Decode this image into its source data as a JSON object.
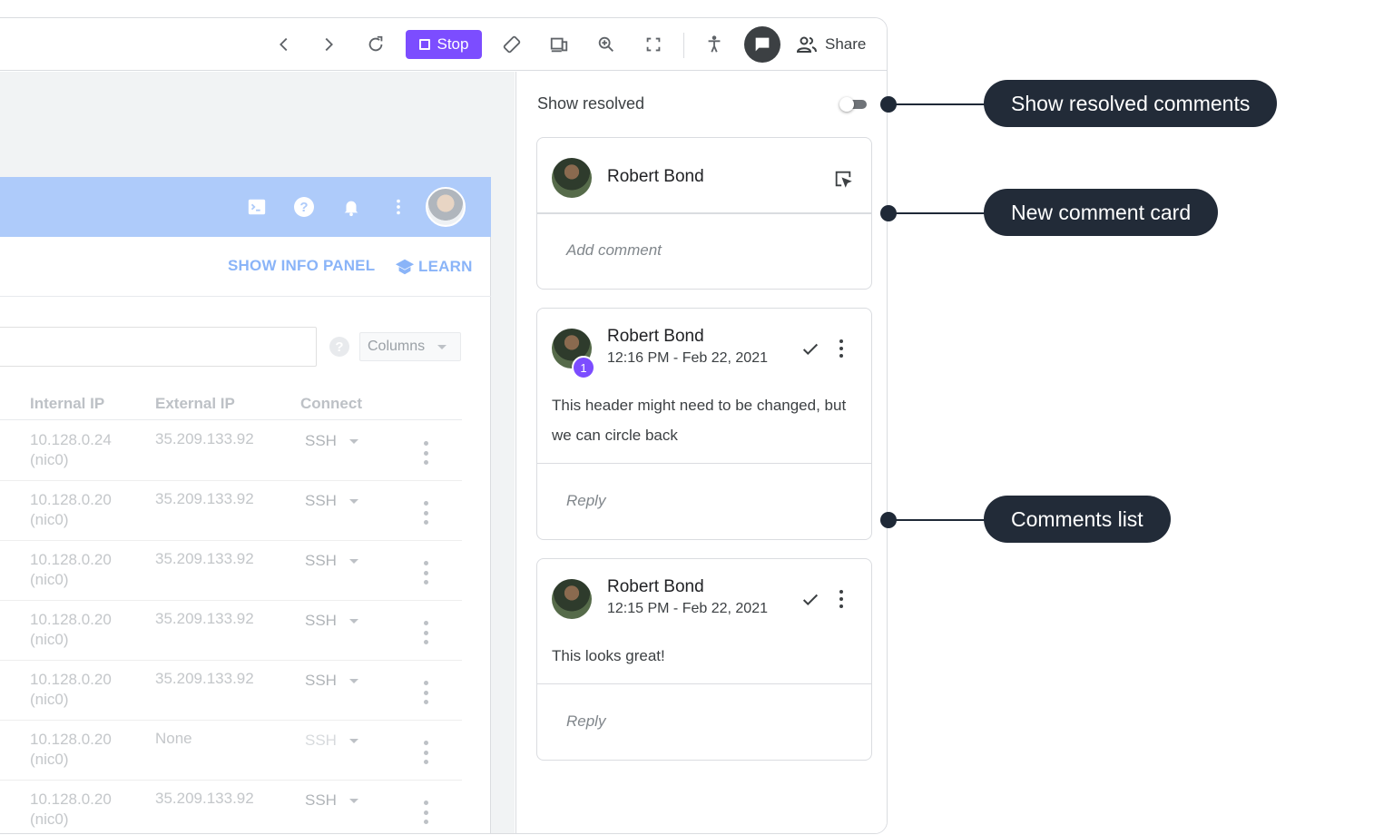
{
  "toolbar": {
    "stop_label": "Stop",
    "share_label": "Share",
    "accent_color": "#7c4dff"
  },
  "app": {
    "show_info_panel": "SHOW INFO PANEL",
    "learn": "LEARN",
    "columns": "Columns",
    "help": "?",
    "table": {
      "headers": [
        "Internal IP",
        "External IP",
        "Connect"
      ],
      "rows": [
        {
          "ip": "10.128.0.24",
          "nic": "(nic0)",
          "ext": "35.209.133.92",
          "connect": "SSH"
        },
        {
          "ip": "10.128.0.20",
          "nic": "(nic0)",
          "ext": "35.209.133.92",
          "connect": "SSH"
        },
        {
          "ip": "10.128.0.20",
          "nic": "(nic0)",
          "ext": "35.209.133.92",
          "connect": "SSH"
        },
        {
          "ip": "10.128.0.20",
          "nic": "(nic0)",
          "ext": "35.209.133.92",
          "connect": "SSH"
        },
        {
          "ip": "10.128.0.20",
          "nic": "(nic0)",
          "ext": "35.209.133.92",
          "connect": "SSH"
        },
        {
          "ip": "10.128.0.20",
          "nic": "(nic0)",
          "ext": "None",
          "connect": "SSH"
        },
        {
          "ip": "10.128.0.20",
          "nic": "(nic0)",
          "ext": "35.209.133.92",
          "connect": "SSH"
        }
      ]
    }
  },
  "panel": {
    "show_resolved": "Show resolved",
    "new_comment": {
      "author": "Robert Bond",
      "placeholder": "Add comment"
    },
    "comments": [
      {
        "author": "Robert Bond",
        "time": "12:16 PM - Feb 22, 2021",
        "badge": "1",
        "text": "This header might need to be changed, but we can circle back",
        "reply_placeholder": "Reply"
      },
      {
        "author": "Robert Bond",
        "time": "12:15 PM - Feb 22, 2021",
        "text": "This looks great!",
        "reply_placeholder": "Reply"
      }
    ]
  },
  "callouts": {
    "show_resolved": "Show resolved comments",
    "new_comment": "New comment card",
    "comments_list": "Comments list"
  }
}
